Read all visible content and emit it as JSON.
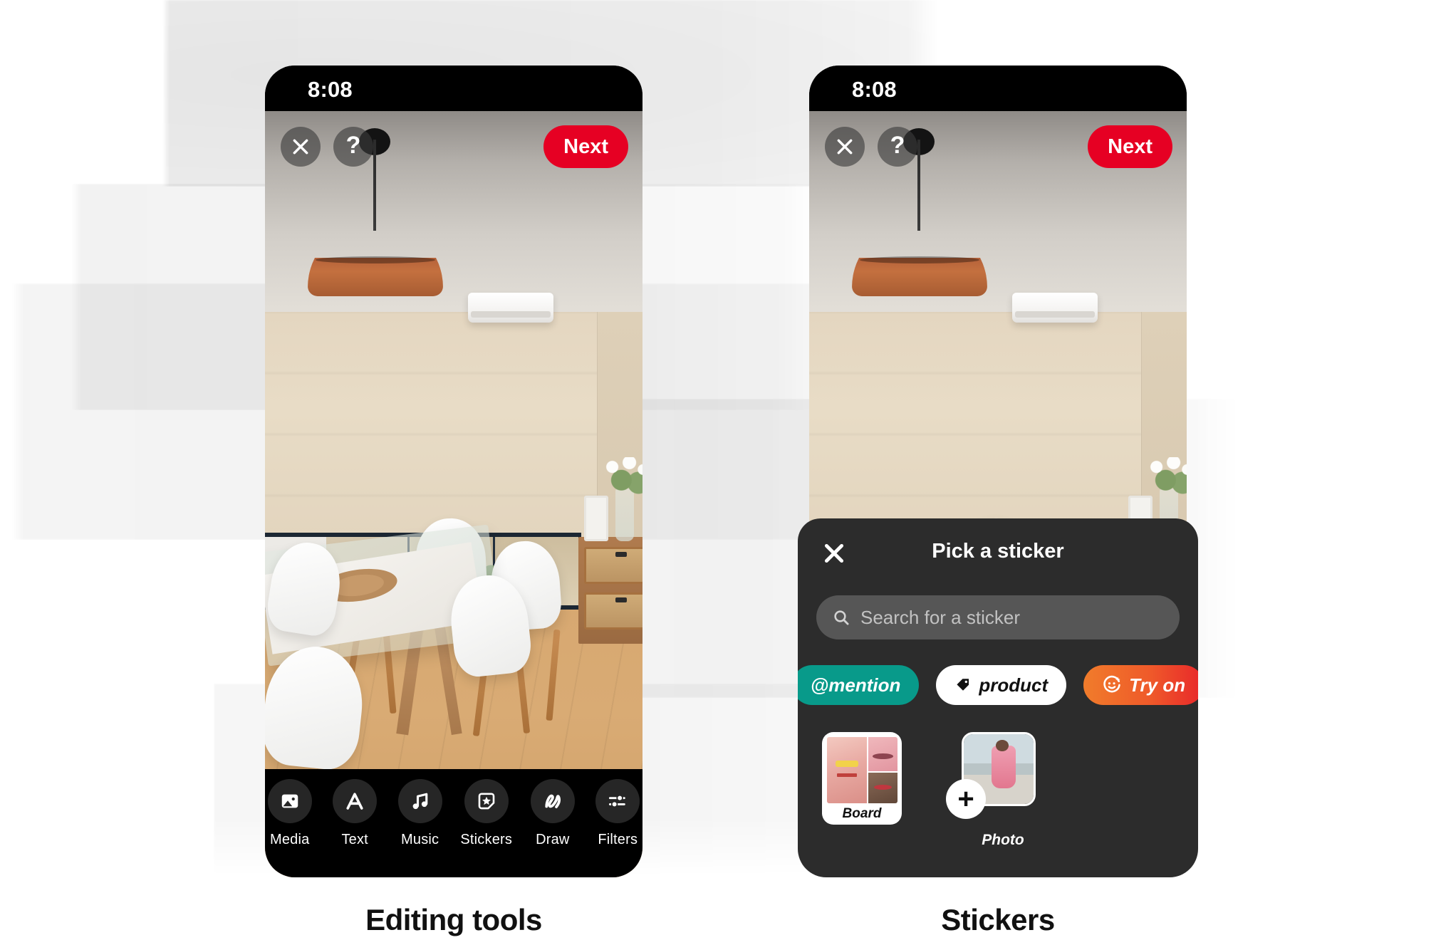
{
  "background": {
    "accent_red": "#e60023",
    "sheet_bg": "#2c2c2c",
    "teal": "#089a8a"
  },
  "phones": [
    {
      "id": "editing-tools",
      "status_bar": {
        "time": "8:08"
      },
      "top_controls": {
        "close_label": "close-icon",
        "help_label": "?",
        "next_label": "Next"
      },
      "toolbar": {
        "items": [
          {
            "icon": "media-image-icon",
            "label": "Media"
          },
          {
            "icon": "text-letter-a-icon",
            "label": "Text"
          },
          {
            "icon": "music-note-icon",
            "label": "Music"
          },
          {
            "icon": "sticker-star-icon",
            "label": "Stickers"
          },
          {
            "icon": "draw-scribble-icon",
            "label": "Draw"
          },
          {
            "icon": "filters-sliders-icon",
            "label": "Filters"
          }
        ]
      },
      "caption": "Editing tools"
    },
    {
      "id": "stickers",
      "status_bar": {
        "time": "8:08"
      },
      "top_controls": {
        "close_label": "close-icon",
        "help_label": "?",
        "next_label": "Next"
      },
      "sticker_sheet": {
        "title": "Pick a sticker",
        "close_label": "close-icon",
        "search": {
          "placeholder": "Search for a sticker",
          "value": "",
          "icon": "search-icon"
        },
        "pills": [
          {
            "label": "@mention",
            "icon": "",
            "color": "#089a8a"
          },
          {
            "label": "product",
            "icon": "price-tag-icon",
            "color": "#ffffff"
          },
          {
            "label": "Try on",
            "icon": "smiley-sparkle-icon",
            "color": "#ef5a2a"
          }
        ],
        "cards": [
          {
            "label": "Board",
            "type": "board-collage"
          },
          {
            "label": "Photo",
            "type": "photo-add",
            "badge": "+"
          }
        ]
      },
      "caption": "Stickers"
    }
  ]
}
